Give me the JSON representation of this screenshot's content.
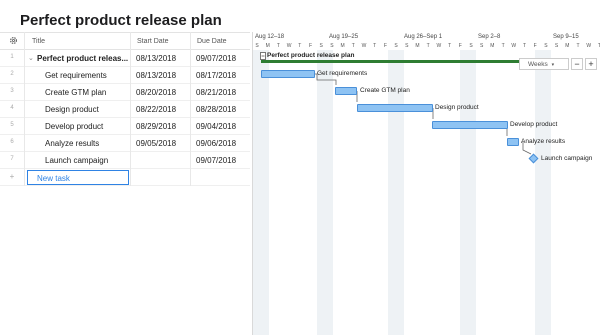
{
  "page": {
    "title": "Perfect product release plan"
  },
  "grid": {
    "headers": {
      "title": "Title",
      "start": "Start Date",
      "due": "Due Date"
    },
    "rows": [
      {
        "num": "1",
        "title": "Perfect product releas...",
        "start": "08/13/2018",
        "due": "09/07/2018"
      },
      {
        "num": "2",
        "title": "Get requirements",
        "start": "08/13/2018",
        "due": "08/17/2018"
      },
      {
        "num": "3",
        "title": "Create GTM plan",
        "start": "08/20/2018",
        "due": "08/21/2018"
      },
      {
        "num": "4",
        "title": "Design product",
        "start": "08/22/2018",
        "due": "08/28/2018"
      },
      {
        "num": "5",
        "title": "Develop product",
        "start": "08/29/2018",
        "due": "09/04/2018"
      },
      {
        "num": "6",
        "title": "Analyze results",
        "start": "09/05/2018",
        "due": "09/06/2018"
      },
      {
        "num": "7",
        "title": "Launch campaign",
        "start": "",
        "due": "09/07/2018"
      }
    ],
    "new_task": {
      "num": "+",
      "label": "New task"
    }
  },
  "timeline": {
    "weeks": [
      "Aug 12–18",
      "Aug 19–25",
      "Aug 26–Sep 1",
      "Sep 2–8",
      "Sep 9–15"
    ],
    "days": [
      "S",
      "M",
      "T",
      "W",
      "T",
      "F",
      "S"
    ],
    "zoom": {
      "label": "Weeks",
      "caret": "▾",
      "minus": "−",
      "plus": "+"
    },
    "project_label": "Perfect product release plan",
    "tasks": [
      {
        "label": "Get requirements"
      },
      {
        "label": "Create GTM plan"
      },
      {
        "label": "Design product"
      },
      {
        "label": "Develop product"
      },
      {
        "label": "Analyze results"
      },
      {
        "label": "Launch campaign"
      }
    ]
  },
  "colors": {
    "bar": "#8ec3f3",
    "bar_border": "#4a90d9",
    "project": "#2e7d32",
    "accent": "#2f83e4"
  }
}
